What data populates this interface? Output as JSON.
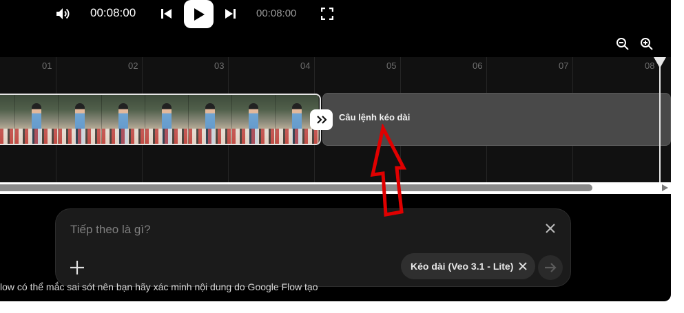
{
  "player": {
    "current_time": "00:08:00",
    "duration": "00:08:00",
    "icons": [
      "volume-icon",
      "skip-previous-icon",
      "play-icon",
      "skip-next-icon",
      "fullscreen-icon"
    ]
  },
  "zoom": {
    "icons": [
      "zoom-out-icon",
      "zoom-in-icon"
    ]
  },
  "timeline": {
    "ticks": [
      "01",
      "02",
      "03",
      "04",
      "05",
      "06",
      "07",
      "08"
    ],
    "extend_clip_label": "Câu lệnh kéo dài"
  },
  "prompt": {
    "placeholder": "Tiếp theo là gì?",
    "chip_label": "Kéo dài (Veo 3.1 - Lite)"
  },
  "disclaimer": "low có thể mắc sai sót nên bạn hãy xác minh nội dung do Google Flow tạo",
  "colors": {
    "background": "#000000",
    "timeline": "#111111",
    "annotation_arrow": "#e00000"
  }
}
